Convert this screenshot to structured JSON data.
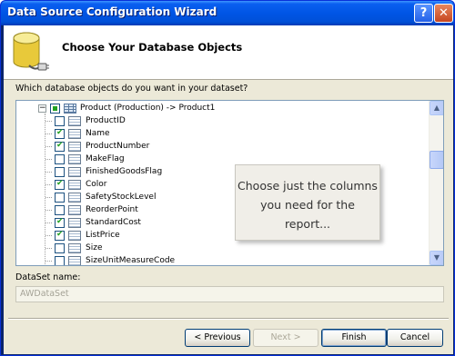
{
  "window": {
    "title": "Data Source Configuration Wizard",
    "help_glyph": "?",
    "close_glyph": "✕"
  },
  "header": {
    "title": "Choose Your Database Objects",
    "icon": "database-plug-icon"
  },
  "prompt": "Which database objects do you want in your dataset?",
  "tree": {
    "table": {
      "label": "Product (Production) -> Product1",
      "expanded": true,
      "state": "partial",
      "expander": "−"
    },
    "columns": [
      {
        "label": "ProductID",
        "checked": false
      },
      {
        "label": "Name",
        "checked": true
      },
      {
        "label": "ProductNumber",
        "checked": true
      },
      {
        "label": "MakeFlag",
        "checked": false
      },
      {
        "label": "FinishedGoodsFlag",
        "checked": false
      },
      {
        "label": "Color",
        "checked": true
      },
      {
        "label": "SafetyStockLevel",
        "checked": false
      },
      {
        "label": "ReorderPoint",
        "checked": false
      },
      {
        "label": "StandardCost",
        "checked": true
      },
      {
        "label": "ListPrice",
        "checked": true
      },
      {
        "label": "Size",
        "checked": false
      },
      {
        "label": "SizeUnitMeasureCode",
        "checked": false
      }
    ]
  },
  "callout": {
    "line1": "Choose just the columns",
    "line2": "you need for the",
    "line3": "report..."
  },
  "dataset": {
    "label": "DataSet name:",
    "value": "AWDataSet"
  },
  "buttons": {
    "previous": "< Previous",
    "next": "Next >",
    "finish": "Finish",
    "cancel": "Cancel"
  },
  "colors": {
    "titlebar": "#0055e5",
    "check": "#21a121",
    "dialog_bg": "#ece9d8"
  }
}
